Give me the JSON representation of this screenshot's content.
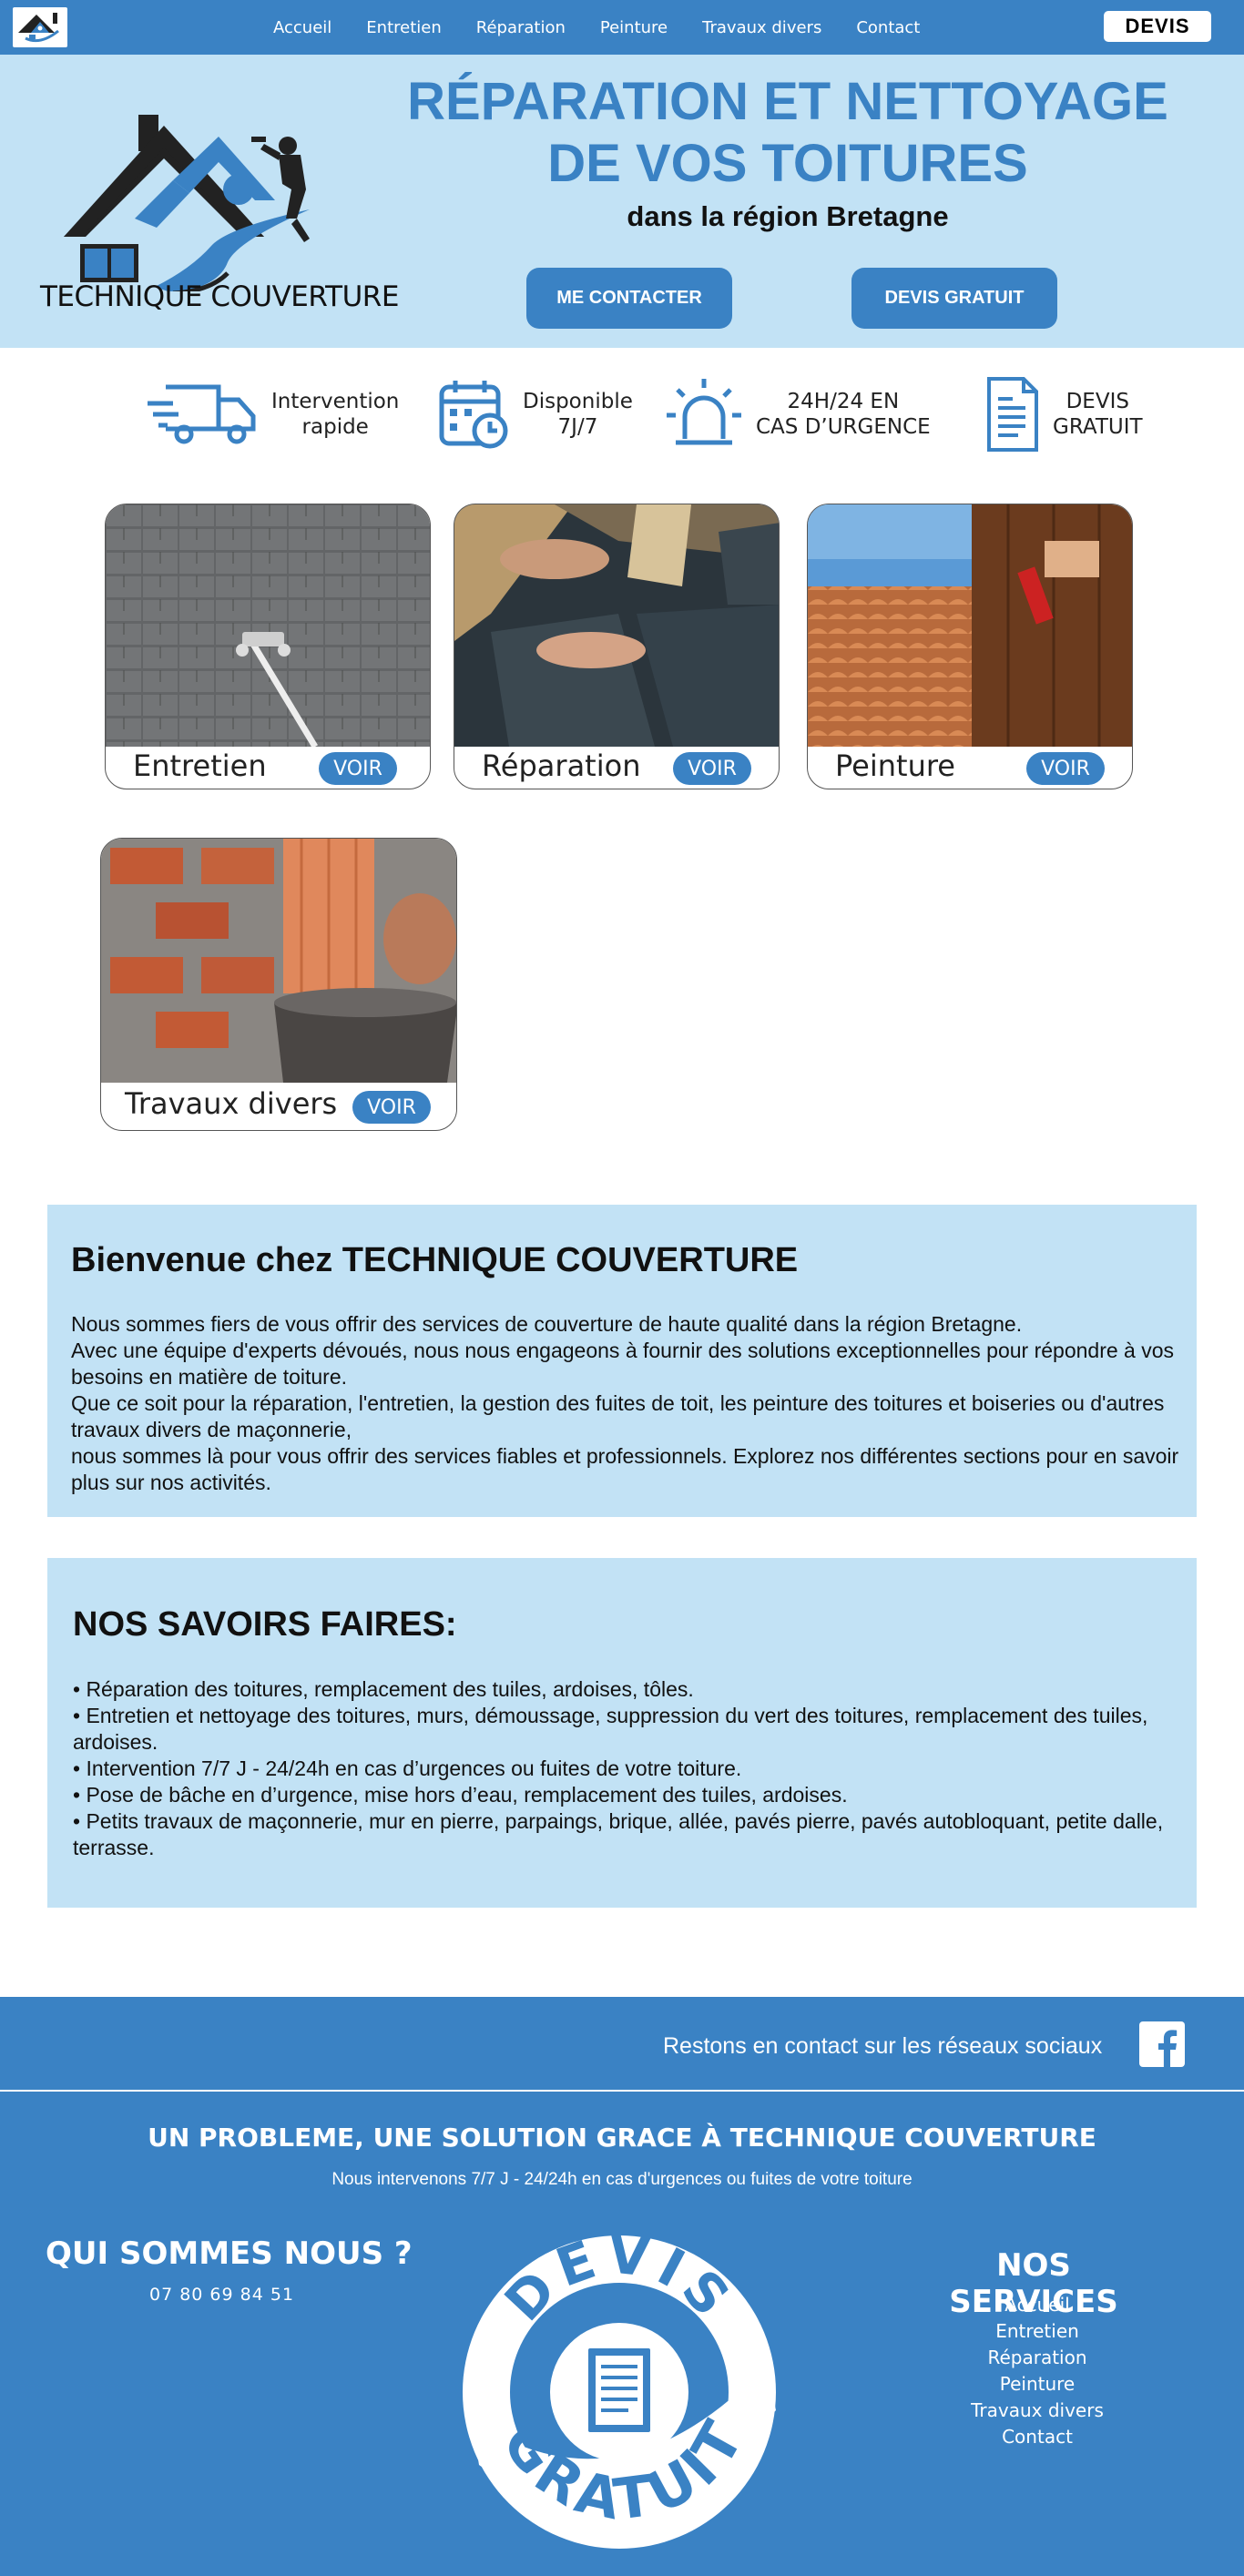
{
  "colors": {
    "primary_blue": "#3a82c4",
    "light_blue": "#c2e2f5",
    "white": "#ffffff",
    "dark": "#111111"
  },
  "nav": {
    "links": [
      "Accueil",
      "Entretien",
      "Réparation",
      "Peinture",
      "Travaux divers",
      "Contact"
    ],
    "devis_label": "DEVIS"
  },
  "hero": {
    "logo_text": "TECHNIQUE COUVERTURE",
    "title_line1": "RÉPARATION ET NETTOYAGE",
    "title_line2": "DE VOS TOITURES",
    "subtitle": "dans la région Bretagne",
    "contact_button": "ME CONTACTER",
    "devis_button": "DEVIS GRATUIT"
  },
  "features": [
    {
      "icon": "truck-icon",
      "text": "Intervention\nrapide"
    },
    {
      "icon": "calendar-clock-icon",
      "text": "Disponible\n7J/7"
    },
    {
      "icon": "alarm-light-icon",
      "text": "24H/24 EN\nCAS D’URGENCE"
    },
    {
      "icon": "document-icon",
      "text": "DEVIS\nGRATUIT"
    }
  ],
  "cards": [
    {
      "title": "Entretien",
      "button": "VOIR",
      "image": "roof-cleaning-photo"
    },
    {
      "title": "Réparation",
      "button": "VOIR",
      "image": "slate-repair-photo"
    },
    {
      "title": "Peinture",
      "button": "VOIR",
      "image": "roof-tiles-and-wood-painting-photo"
    },
    {
      "title": "Travaux divers",
      "button": "VOIR",
      "image": "brick-masonry-photo"
    }
  ],
  "welcome": {
    "title": "Bienvenue chez TECHNIQUE COUVERTURE",
    "lines": [
      "Nous sommes fiers de vous offrir des services de couverture de haute qualité dans la région Bretagne.",
      "Avec une équipe d'experts dévoués, nous nous engageons à fournir des solutions exceptionnelles pour répondre à vos besoins en matière de toiture.",
      "Que ce soit pour la réparation, l'entretien, la gestion des fuites de toit, les peinture des toitures et boiseries ou d'autres travaux divers de maçonnerie,",
      "nous sommes là pour vous offrir des services fiables et professionnels. Explorez nos différentes sections pour en savoir plus sur nos activités."
    ]
  },
  "savoirs": {
    "title": "NOS SAVOIRS FAIRES:",
    "items": [
      "• Réparation des toitures, remplacement des tuiles, ardoises, tôles.",
      "• Entretien et nettoyage des toitures, murs, démoussage, suppression du vert des toitures, remplacement des tuiles, ardoises.",
      "• Intervention 7/7 J - 24/24h en cas d’urgences ou fuites de votre toiture.",
      "• Pose de bâche en d’urgence, mise hors d’eau, remplacement des tuiles, ardoises.",
      "• Petits travaux de maçonnerie, mur en pierre, parpaings, brique, allée, pavés pierre, pavés autobloquant, petite dalle, terrasse."
    ]
  },
  "footer": {
    "social_text": "Restons en contact sur les réseaux sociaux",
    "social_icon": "facebook-icon",
    "headline": "UN PROBLEME, UNE SOLUTION GRACE À TECHNIQUE COUVERTURE",
    "subline": "Nous intervenons 7/7 J - 24/24h en cas d'urgences ou fuites de votre toiture",
    "qui_title": "QUI SOMMES NOUS ?",
    "phone": "07 80 69 84 51",
    "badge_top": "DEVIS",
    "badge_bottom": "GRATUIT",
    "services_title": "NOS SERVICES",
    "services": [
      "Accueil",
      "Entretien",
      "Réparation",
      "Peinture",
      "Travaux divers",
      "Contact"
    ]
  }
}
